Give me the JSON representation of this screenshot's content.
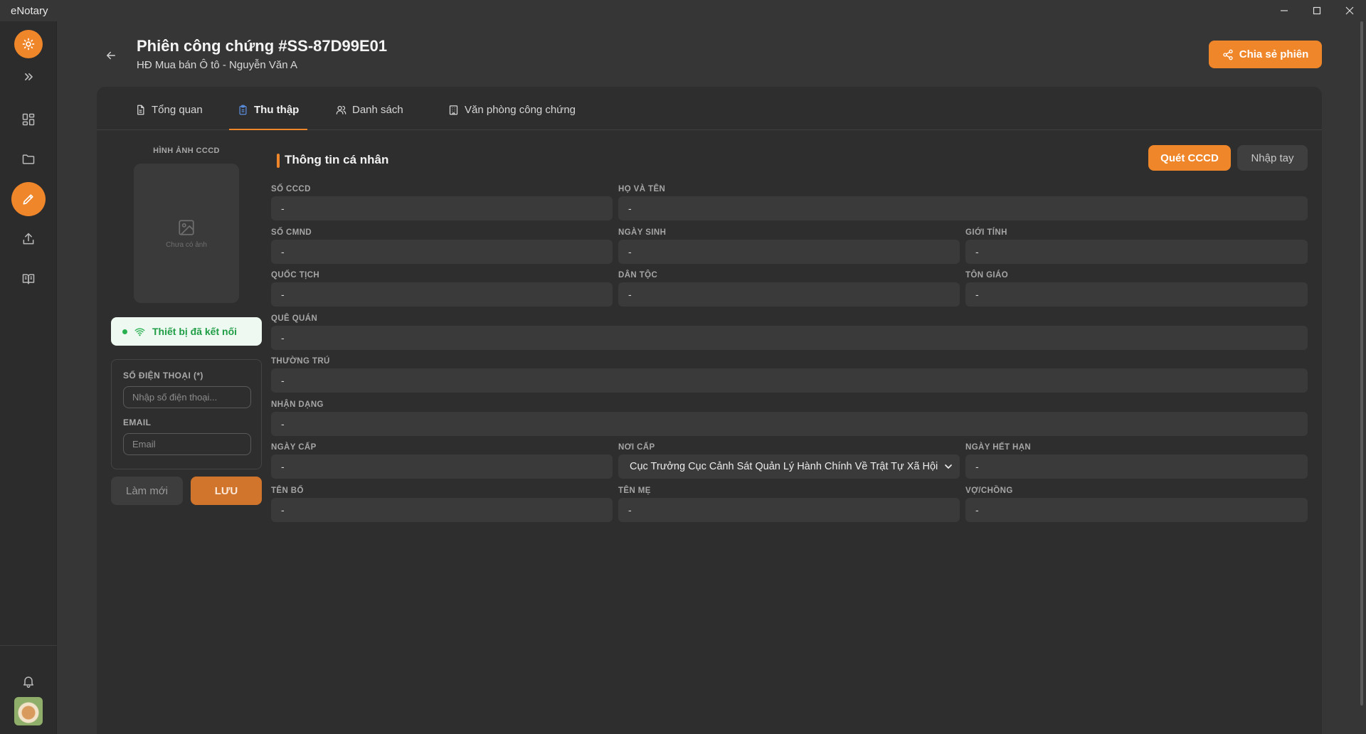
{
  "app": {
    "title": "eNotary"
  },
  "header": {
    "title": "Phiên công chứng #SS-87D99E01",
    "subtitle": "HĐ Mua bán Ô tô - Nguyễn Văn A",
    "share_label": "Chia sẻ phiên"
  },
  "tabs": [
    {
      "label": "Tổng quan",
      "icon": "document-icon"
    },
    {
      "label": "Thu thập",
      "icon": "clipboard-icon",
      "active": true
    },
    {
      "label": "Danh sách",
      "icon": "users-icon"
    },
    {
      "label": "Văn phòng công chứng",
      "icon": "building-icon"
    }
  ],
  "left": {
    "image_label": "HÌNH ẢNH CCCD",
    "image_empty": "Chưa có ảnh",
    "device_status": "Thiết bị đã kết nối",
    "phone_label": "SỐ ĐIỆN THOẠI (*)",
    "phone_placeholder": "Nhập số điện thoại...",
    "email_label": "EMAIL",
    "email_placeholder": "Email",
    "reset_label": "Làm mới",
    "save_label": "LƯU"
  },
  "section": {
    "title": "Thông tin cá nhân",
    "scan_label": "Quét CCCD",
    "manual_label": "Nhập tay"
  },
  "fields": {
    "cccd": {
      "label": "SỐ CCCD",
      "value": "-"
    },
    "fullname": {
      "label": "HỌ VÀ TÊN",
      "value": "-"
    },
    "cmnd": {
      "label": "SỐ CMND",
      "value": "-"
    },
    "dob": {
      "label": "NGÀY SINH",
      "value": "-"
    },
    "gender": {
      "label": "GIỚI TÍNH",
      "value": "-"
    },
    "nationality": {
      "label": "QUỐC TỊCH",
      "value": "-"
    },
    "ethnicity": {
      "label": "DÂN TỘC",
      "value": "-"
    },
    "religion": {
      "label": "TÔN GIÁO",
      "value": "-"
    },
    "hometown": {
      "label": "QUÊ QUÁN",
      "value": "-"
    },
    "residence": {
      "label": "THƯỜNG TRÚ",
      "value": "-"
    },
    "identification": {
      "label": "NHẬN DẠNG",
      "value": "-"
    },
    "issue_date": {
      "label": "NGÀY CẤP",
      "value": "-"
    },
    "issue_place": {
      "label": "NƠI CẤP",
      "value": "Cục Trưởng Cục Cảnh Sát Quản Lý Hành Chính Về Trật Tự Xã Hội"
    },
    "expiry_date": {
      "label": "NGÀY HẾT HẠN",
      "value": "-"
    },
    "father": {
      "label": "TÊN BỐ",
      "value": "-"
    },
    "mother": {
      "label": "TÊN MẸ",
      "value": "-"
    },
    "spouse": {
      "label": "VỢ/CHỒNG",
      "value": "-"
    }
  },
  "colors": {
    "accent": "#f0862a",
    "success": "#28b050",
    "background": "#363636",
    "panel": "#2e2e2e"
  }
}
